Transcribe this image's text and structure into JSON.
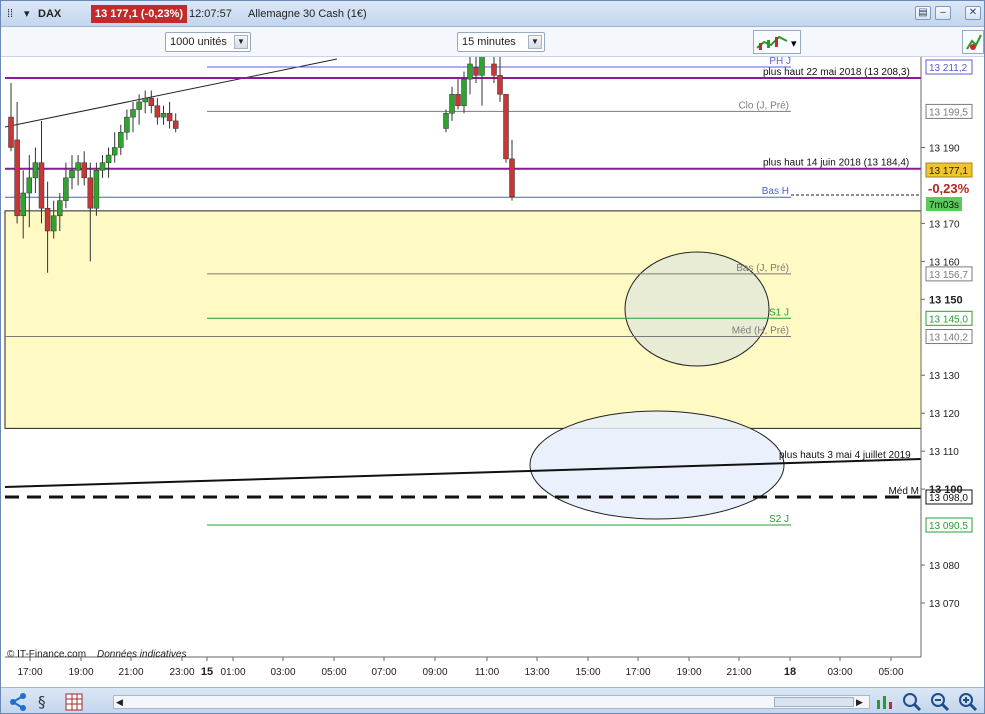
{
  "window": {
    "index": "DAX",
    "price_badge": "13 177,1 (-0,23%)",
    "time": "12:07:57",
    "instrument": "Allemagne 30 Cash (1€)"
  },
  "toolbar": {
    "units_dropdown": "1000 unités",
    "timeframe_dropdown": "15 minutes"
  },
  "chart_data": {
    "type": "candlestick",
    "x_ticks": [
      "17:00",
      "19:00",
      "21:00",
      "23:00",
      "15",
      "01:00",
      "03:00",
      "05:00",
      "07:00",
      "09:00",
      "11:00",
      "13:00",
      "15:00",
      "17:00",
      "19:00",
      "21:00",
      "18",
      "03:00",
      "05:00"
    ],
    "y_ticks": [
      "13 190",
      "13 170",
      "13 160",
      "13 150",
      "13 130",
      "13 120",
      "13 110",
      "13 100",
      "13 080",
      "13 070"
    ],
    "ylim": [
      13062,
      13216
    ],
    "levels": [
      {
        "label": "PH J",
        "value": 13211.2,
        "tag": "13 211,2",
        "color": "#5b5fd6"
      },
      {
        "label": "plus haut 22 mai 2018 (13 208,3)",
        "value": 13208.3,
        "color": "#8a1a9a"
      },
      {
        "label": "Clo (J, Pré)",
        "value": 13199.5,
        "tag": "13 199,5",
        "color": "#7b7b7b"
      },
      {
        "label": "plus haut 14 juin 2018 (13 184,4)",
        "value": 13184.4,
        "color": "#8a1a9a"
      },
      {
        "label": "Bas H",
        "value": 13176.9,
        "color": "#4a5fd0"
      },
      {
        "label": "Bas (J, Pré)",
        "value": 13156.7,
        "tag": "13 156,7",
        "color": "#7b7b7b"
      },
      {
        "label": "S1 J",
        "value": 13145.0,
        "tag": "13 145,0",
        "color": "#23a033"
      },
      {
        "label": "Méd (H, Pré)",
        "value": 13140.2,
        "tag": "13 140,2",
        "color": "#7b7b7b"
      },
      {
        "label": "plus hauts 3 mai 4 juillet 2019",
        "value": 13110.0,
        "color": "#111111"
      },
      {
        "label": "Méd M",
        "value": 13098.0,
        "tag": "13 098,0",
        "color": "#111111"
      },
      {
        "label": "S2 J",
        "value": 13090.5,
        "tag": "13 090,5",
        "color": "#23a033"
      }
    ],
    "last_price": {
      "value": 13177.1,
      "tag": "13 177,1",
      "change": "-0,23%",
      "countdown": "7m03s"
    },
    "candles": [
      {
        "o": 13198,
        "h": 13207,
        "l": 13189,
        "c": 13190
      },
      {
        "o": 13192,
        "h": 13202,
        "l": 13170,
        "c": 13172
      },
      {
        "o": 13172,
        "h": 13184,
        "l": 13166,
        "c": 13178
      },
      {
        "o": 13178,
        "h": 13188,
        "l": 13169,
        "c": 13182
      },
      {
        "o": 13182,
        "h": 13190,
        "l": 13178,
        "c": 13186
      },
      {
        "o": 13186,
        "h": 13197,
        "l": 13170,
        "c": 13174
      },
      {
        "o": 13174,
        "h": 13181,
        "l": 13157,
        "c": 13168
      },
      {
        "o": 13168,
        "h": 13176,
        "l": 13166,
        "c": 13172
      },
      {
        "o": 13172,
        "h": 13178,
        "l": 13168,
        "c": 13176
      },
      {
        "o": 13176,
        "h": 13186,
        "l": 13174,
        "c": 13182
      },
      {
        "o": 13182,
        "h": 13188,
        "l": 13179,
        "c": 13184
      },
      {
        "o": 13184,
        "h": 13188,
        "l": 13180,
        "c": 13186
      },
      {
        "o": 13186,
        "h": 13189,
        "l": 13180,
        "c": 13182
      },
      {
        "o": 13182,
        "h": 13186,
        "l": 13160,
        "c": 13174
      },
      {
        "o": 13174,
        "h": 13186,
        "l": 13172,
        "c": 13184
      },
      {
        "o": 13184,
        "h": 13188,
        "l": 13182,
        "c": 13186
      },
      {
        "o": 13186,
        "h": 13190,
        "l": 13182,
        "c": 13188
      },
      {
        "o": 13188,
        "h": 13194,
        "l": 13186,
        "c": 13190
      },
      {
        "o": 13190,
        "h": 13196,
        "l": 13188,
        "c": 13194
      },
      {
        "o": 13194,
        "h": 13200,
        "l": 13192,
        "c": 13198
      },
      {
        "o": 13198,
        "h": 13202,
        "l": 13194,
        "c": 13200
      },
      {
        "o": 13200,
        "h": 13204,
        "l": 13196,
        "c": 13202
      },
      {
        "o": 13202,
        "h": 13205,
        "l": 13199,
        "c": 13203
      },
      {
        "o": 13203,
        "h": 13205,
        "l": 13199,
        "c": 13201
      },
      {
        "o": 13201,
        "h": 13203,
        "l": 13196,
        "c": 13198
      },
      {
        "o": 13198,
        "h": 13201,
        "l": 13196,
        "c": 13199
      },
      {
        "o": 13199,
        "h": 13202,
        "l": 13195,
        "c": 13197
      },
      {
        "o": 13197,
        "h": 13199,
        "l": 13194,
        "c": 13195
      },
      {
        "o": 13195,
        "h": 13200,
        "l": 13194,
        "c": 13199
      },
      {
        "o": 13199,
        "h": 13206,
        "l": 13197,
        "c": 13204
      },
      {
        "o": 13204,
        "h": 13208,
        "l": 13200,
        "c": 13201
      },
      {
        "o": 13201,
        "h": 13210,
        "l": 13199,
        "c": 13208
      },
      {
        "o": 13208,
        "h": 13214,
        "l": 13204,
        "c": 13212
      },
      {
        "o": 13211,
        "h": 13216,
        "l": 13207,
        "c": 13209
      },
      {
        "o": 13209,
        "h": 13216,
        "l": 13201,
        "c": 13214
      },
      {
        "o": 13212,
        "h": 13216,
        "l": 13207,
        "c": 13209
      },
      {
        "o": 13209,
        "h": 13216,
        "l": 13202,
        "c": 13204
      },
      {
        "o": 13204,
        "h": 13190,
        "l": 13186,
        "c": 13187
      },
      {
        "o": 13187,
        "h": 13192,
        "l": 13176,
        "c": 13177
      }
    ]
  },
  "overlay_texts": {
    "copyright": "© IT-Finance.com",
    "disclaimer": "Données indicatives"
  }
}
